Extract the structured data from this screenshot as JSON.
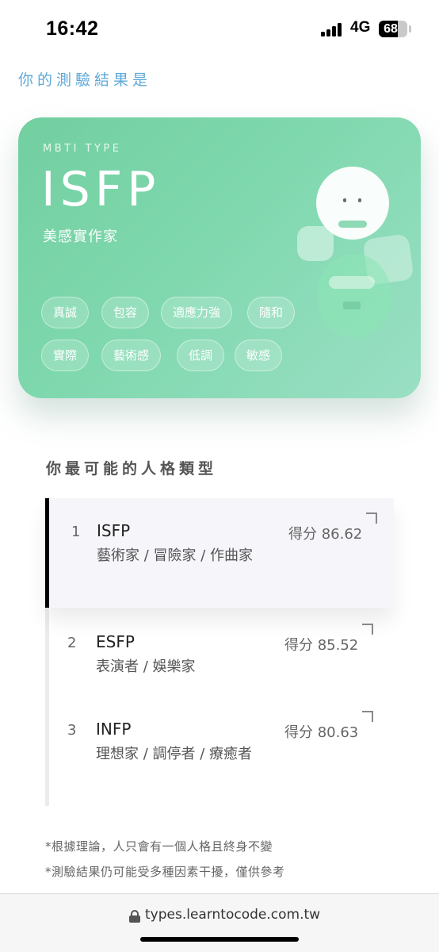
{
  "status_bar": {
    "time": "16:42",
    "network": "4G",
    "battery": "68",
    "battery_level_percent": 68
  },
  "result_heading": "你的測驗結果是",
  "card": {
    "label": "MBTI TYPE",
    "type_code": "ISFP",
    "type_name": "美感實作家",
    "tags": [
      "真誠",
      "包容",
      "適應力強",
      "隨和",
      "實際",
      "藝術感",
      "低調",
      "敏感"
    ],
    "colors": {
      "gradient_start": "#72cfa0",
      "gradient_end": "#9adfc4"
    }
  },
  "ranking": {
    "title": "你最可能的人格類型",
    "items": [
      {
        "rank": "1",
        "type": "ISFP",
        "desc": "藝術家 / 冒險家 / 作曲家",
        "score": "得分 86.62"
      },
      {
        "rank": "2",
        "type": "ESFP",
        "desc": "表演者 / 娛樂家",
        "score": "得分 85.52"
      },
      {
        "rank": "3",
        "type": "INFP",
        "desc": "理想家 / 調停者 / 療癒者",
        "score": "得分 80.63"
      }
    ]
  },
  "notes": [
    "*根據理論，人只會有一個人格且終身不變",
    "*測驗結果仍可能受多種因素干擾，僅供參考"
  ],
  "address_bar": {
    "url": "types.learntocode.com.tw",
    "icon": "lock-icon"
  }
}
